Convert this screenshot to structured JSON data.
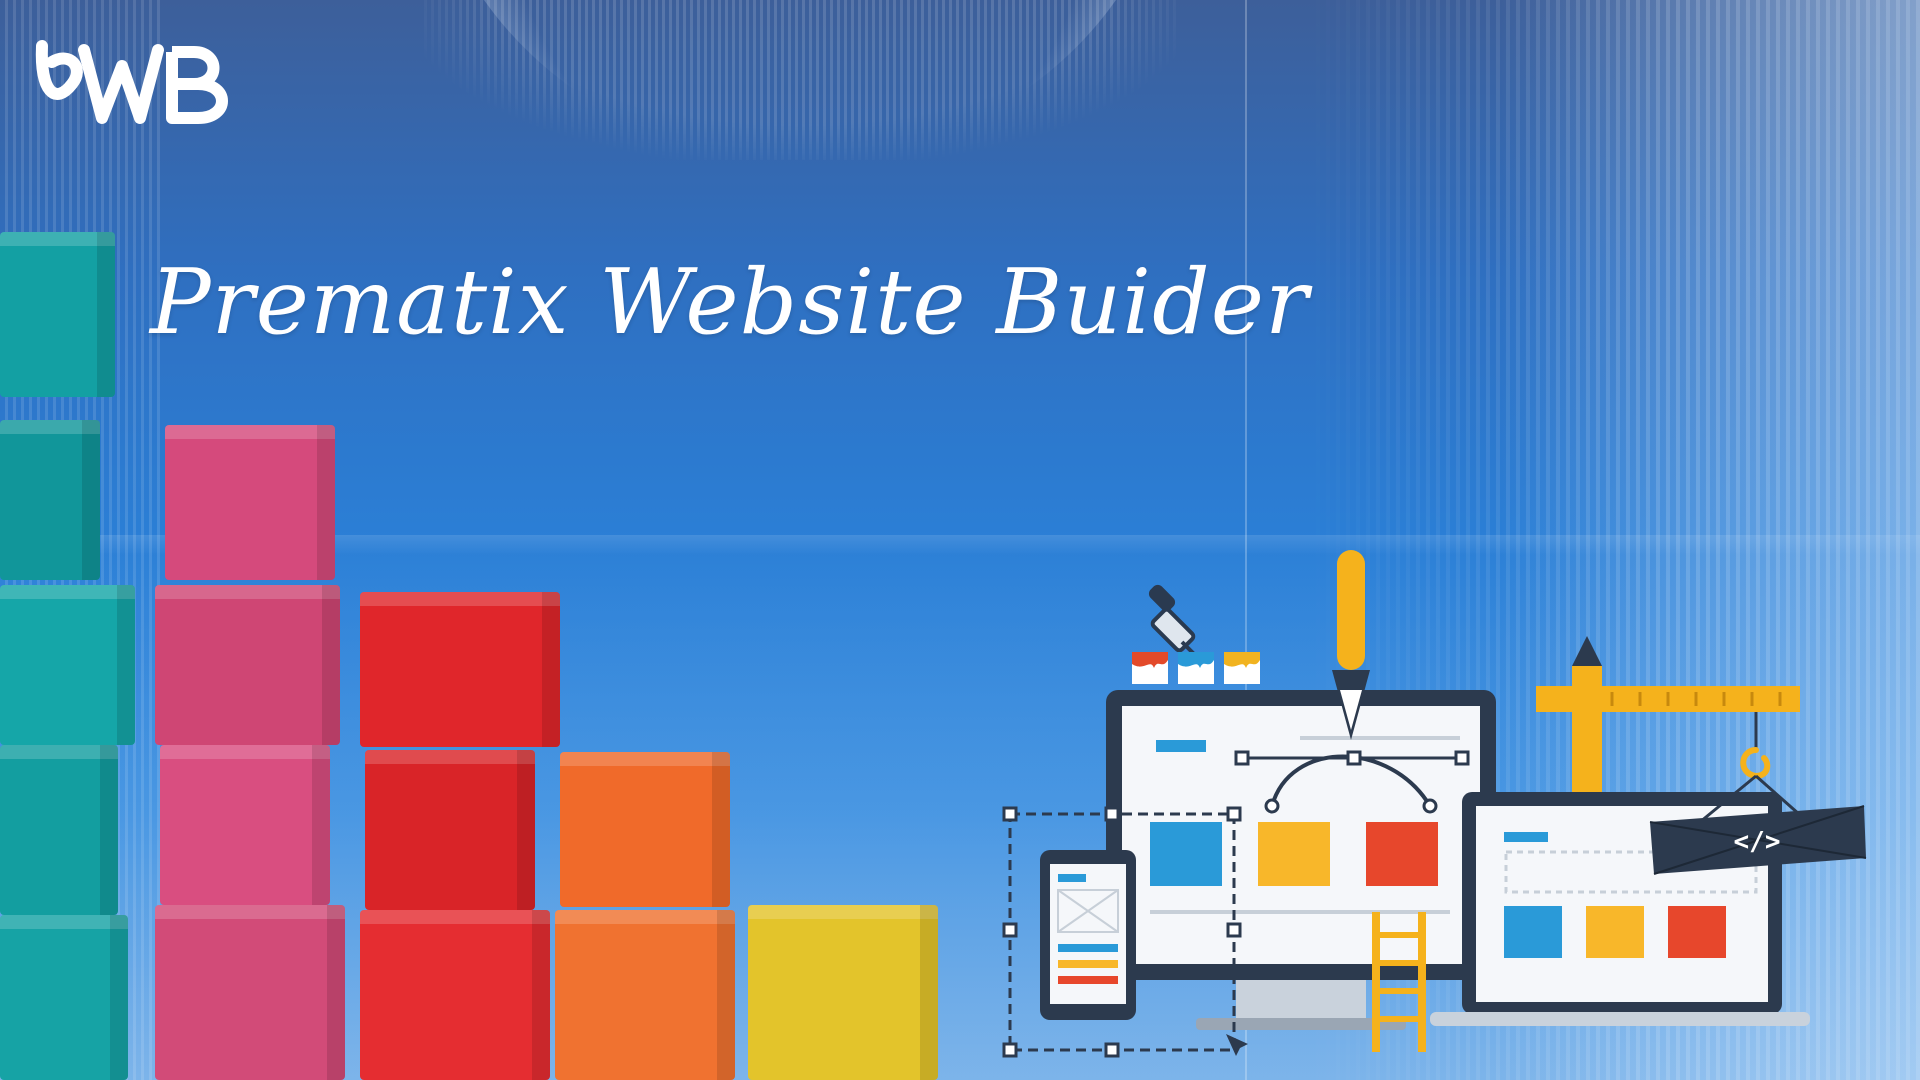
{
  "title": "Prematix Website Buider",
  "logo": {
    "text": "PWB"
  },
  "illustration": {
    "code_tag": "</>"
  },
  "cube_colors": {
    "teal": "#14a7a8",
    "pink": "#d8507e",
    "red": "#e32a2e",
    "orange": "#f2692a",
    "yellow": "#e2c12a"
  }
}
